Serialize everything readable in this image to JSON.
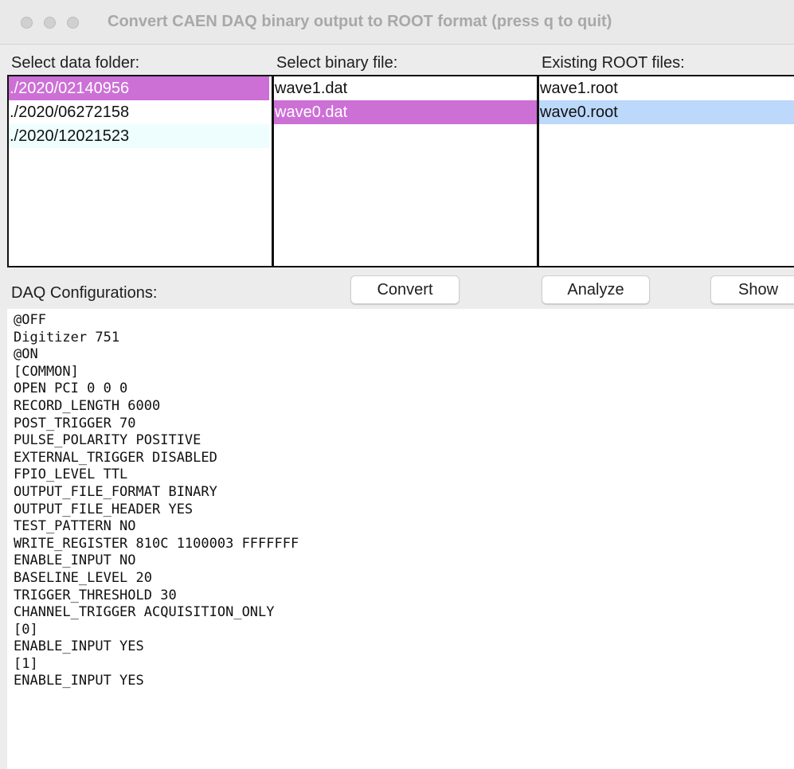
{
  "window": {
    "title": "Convert CAEN DAQ binary output to ROOT format (press q to quit)"
  },
  "folders": {
    "label": "Select data folder:",
    "items": [
      "./2020/02140956",
      "./2020/06272158",
      "./2020/12021523"
    ]
  },
  "binary_files": {
    "label": "Select binary file:",
    "items": [
      "wave1.dat",
      "wave0.dat"
    ]
  },
  "root_files": {
    "label": "Existing ROOT files:",
    "items": [
      "wave1.root",
      "wave0.root"
    ]
  },
  "config": {
    "label": "DAQ Configurations:",
    "lines": [
      "@OFF",
      "Digitizer 751",
      "@ON",
      "[COMMON]",
      "OPEN PCI 0 0 0",
      "RECORD_LENGTH 6000",
      "POST_TRIGGER 70",
      "PULSE_POLARITY POSITIVE",
      "EXTERNAL_TRIGGER DISABLED",
      "FPIO_LEVEL TTL",
      "OUTPUT_FILE_FORMAT BINARY",
      "OUTPUT_FILE_HEADER YES",
      "TEST_PATTERN NO",
      "WRITE_REGISTER 810C 1100003 FFFFFFF",
      "ENABLE_INPUT NO",
      "BASELINE_LEVEL 20",
      "TRIGGER_THRESHOLD 30",
      "CHANNEL_TRIGGER ACQUISITION_ONLY",
      "[0]",
      "ENABLE_INPUT YES",
      "[1]",
      "ENABLE_INPUT YES"
    ]
  },
  "buttons": {
    "convert": "Convert",
    "analyze": "Analyze",
    "show": "Show"
  },
  "colors": {
    "selection_magenta": "#cc70d6",
    "selection_blue": "#bcd8fb",
    "highlight_cyan": "#eefefe"
  }
}
